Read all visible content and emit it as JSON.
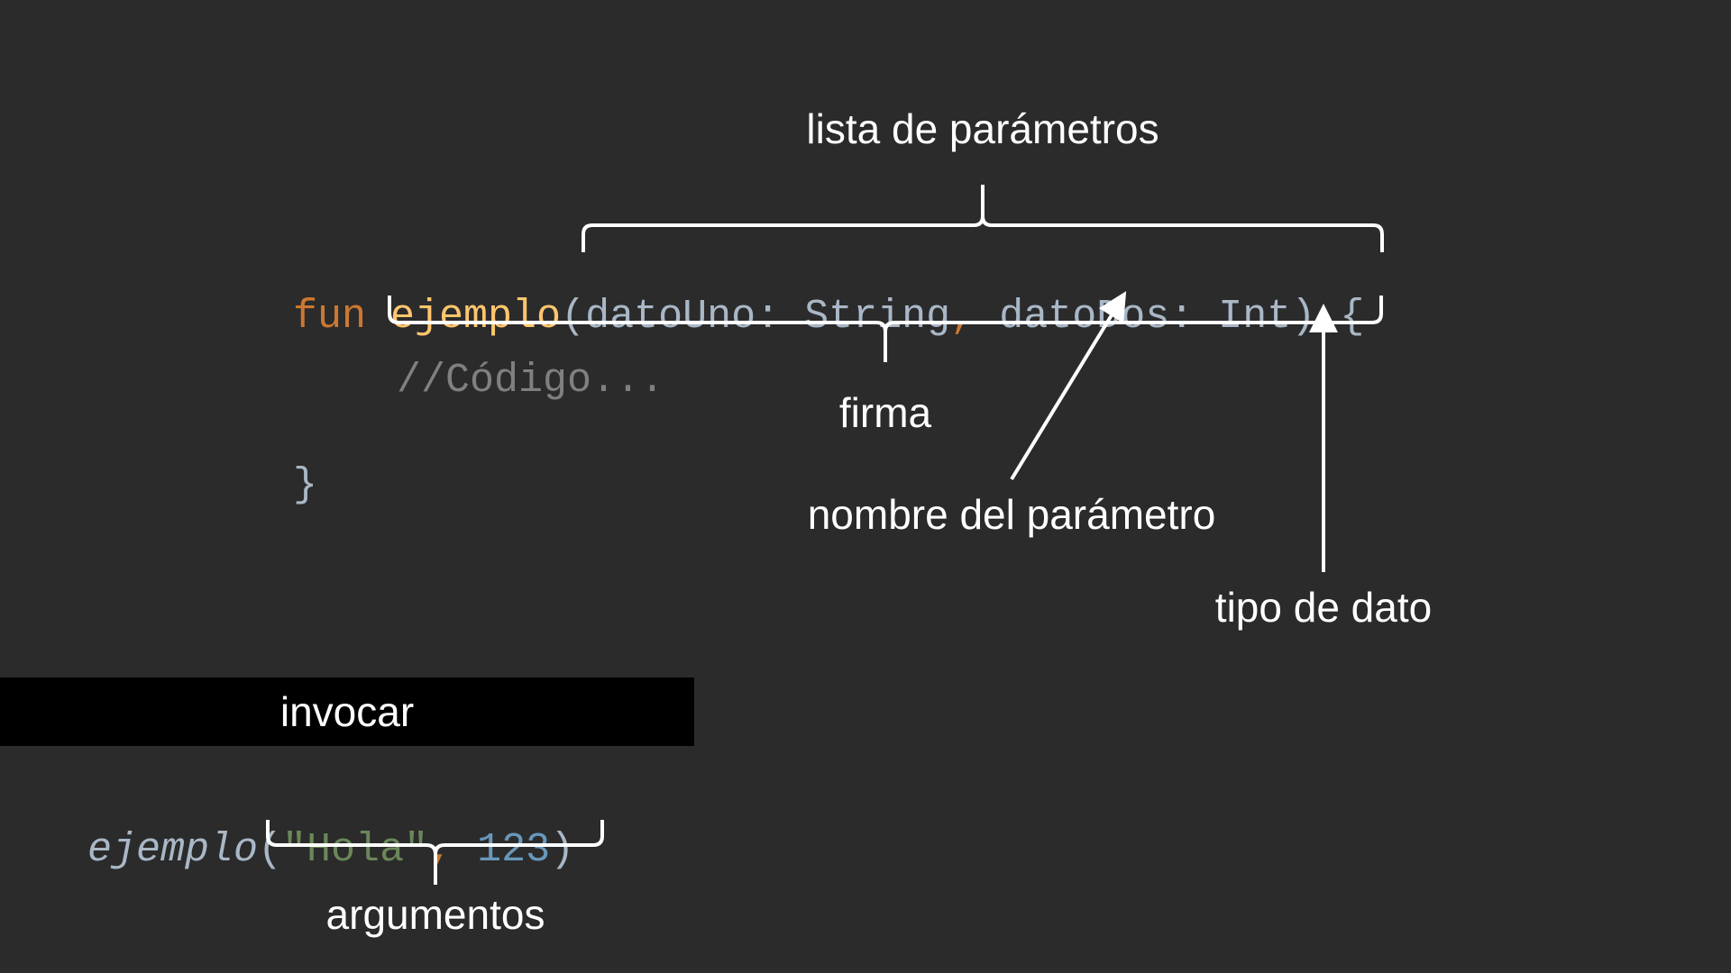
{
  "code": {
    "line1": {
      "keyword": "fun",
      "function_name": "ejemplo",
      "open_paren": "(",
      "param1_name": "datoUno",
      "colon1": ":",
      "param1_type": "String",
      "comma": ",",
      "param2_name": "datoDos",
      "colon2": ":",
      "param2_type": "Int",
      "close_paren": ")",
      "open_brace": "{"
    },
    "comment": "//Código...",
    "close_brace": "}"
  },
  "call": {
    "function_name": "ejemplo",
    "open_paren": "(",
    "arg1": "\"Hola\"",
    "comma": ",",
    "arg2": "123",
    "close_paren": ")"
  },
  "labels": {
    "parameter_list": "lista de parámetros",
    "signature": "firma",
    "parameter_name": "nombre del parámetro",
    "data_type": "tipo de dato",
    "invoke": "invocar",
    "arguments": "argumentos"
  },
  "colors": {
    "background": "#2b2b2b",
    "keyword": "#cc7832",
    "function": "#ffc66d",
    "text": "#a9b7c6",
    "comment": "#808080",
    "string": "#6a8759",
    "number": "#6897bb",
    "annotation": "#ffffff"
  }
}
